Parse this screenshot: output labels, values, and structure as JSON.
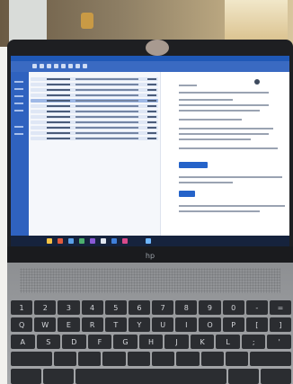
{
  "scene": {
    "room": {
      "wall_color": "#6a5a44",
      "window_color": "#d9bf8a"
    },
    "laptop": {
      "brand_logo": "hp",
      "bezel_color": "#1e1f22",
      "deck_color": "#a5a7aa"
    },
    "screen": {
      "app_kind": "email-client",
      "accent_color": "#1f58b6",
      "selected_row_color": "#9fb9e6",
      "button_color": "#2563c9"
    },
    "keyboard": {
      "rows": [
        [
          "1",
          "2",
          "3",
          "4",
          "5",
          "6",
          "7",
          "8",
          "9",
          "0",
          "-",
          "="
        ],
        [
          "Q",
          "W",
          "E",
          "R",
          "T",
          "Y",
          "U",
          "I",
          "O",
          "P",
          "[",
          "]"
        ],
        [
          "A",
          "S",
          "D",
          "F",
          "G",
          "H",
          "J",
          "K",
          "L",
          ";",
          "'"
        ]
      ]
    }
  }
}
